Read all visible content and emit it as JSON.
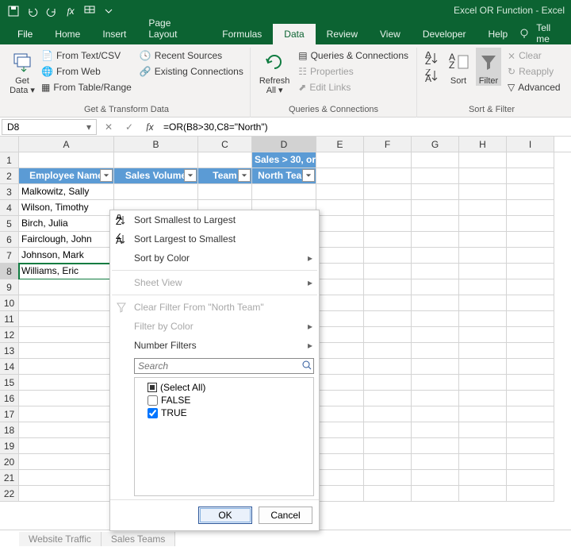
{
  "title": "Excel OR Function - Excel",
  "qat_items": [
    "save",
    "undo",
    "redo",
    "function",
    "table-menu",
    "customize"
  ],
  "tabs": [
    "File",
    "Home",
    "Insert",
    "Page Layout",
    "Formulas",
    "Data",
    "Review",
    "View",
    "Developer",
    "Help"
  ],
  "tellme": "Tell me",
  "active_tab": "Data",
  "groups": {
    "get_transform": {
      "label": "Get & Transform Data",
      "big": "Get\nData",
      "items": [
        "From Text/CSV",
        "From Web",
        "From Table/Range",
        "Recent Sources",
        "Existing Connections"
      ]
    },
    "queries": {
      "label": "Queries & Connections",
      "big": "Refresh\nAll",
      "items": [
        "Queries & Connections",
        "Properties",
        "Edit Links"
      ]
    },
    "sort_filter": {
      "label": "Sort & Filter",
      "big1": "Sort",
      "big2": "Filter",
      "items": [
        "Clear",
        "Reapply",
        "Advanced"
      ]
    }
  },
  "name_box": "D8",
  "formula": "=OR(B8>30,C8=\"North\")",
  "columns": [
    "A",
    "B",
    "C",
    "D",
    "E",
    "F",
    "G",
    "H",
    "I"
  ],
  "headers": {
    "A": "Employee Name",
    "B": "Sales Volume",
    "C": "Team",
    "D_line1": "Sales > 30, or",
    "D_line2": "North Team"
  },
  "data_rows": [
    {
      "n": 3,
      "A": "Malkowitz, Sally"
    },
    {
      "n": 4,
      "A": "Wilson, Timothy"
    },
    {
      "n": 5,
      "A": "Birch, Julia"
    },
    {
      "n": 6,
      "A": "Fairclough, John"
    },
    {
      "n": 7,
      "A": "Johnson, Mark"
    },
    {
      "n": 8,
      "A": "Williams, Eric"
    }
  ],
  "empty_rows": [
    9,
    10,
    11,
    12,
    13,
    14,
    15,
    16,
    17,
    18,
    19,
    20,
    21,
    22
  ],
  "menu": {
    "sort_asc": "Sort Smallest to Largest",
    "sort_desc": "Sort Largest to Smallest",
    "sort_color": "Sort by Color",
    "sheet_view": "Sheet View",
    "clear_filter": "Clear Filter From \"North Team\"",
    "filter_color": "Filter by Color",
    "number_filters": "Number Filters",
    "search_ph": "Search",
    "options": [
      {
        "label": "(Select All)",
        "checked": "mixed"
      },
      {
        "label": "FALSE",
        "checked": false
      },
      {
        "label": "TRUE",
        "checked": true
      }
    ],
    "ok": "OK",
    "cancel": "Cancel"
  },
  "sheet_tabs": [
    "Website Traffic",
    "Sales Teams"
  ]
}
